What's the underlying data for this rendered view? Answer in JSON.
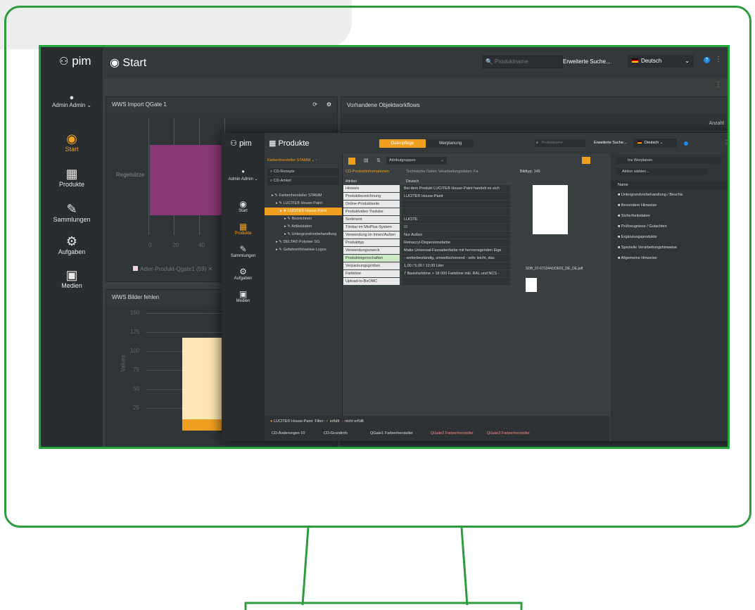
{
  "back": {
    "logo": "pim",
    "user": "Admin Admin",
    "nav": [
      "Start",
      "Produkte",
      "Sammlungen",
      "Aufgaben",
      "Medien"
    ],
    "page_title": "Start",
    "search_placeholder": "Produktname",
    "extended_search": "Erweiterte Suche...",
    "language": "Deutsch",
    "panel1_title": "WWS Import QGate 1",
    "panel2_title": "Vorhandene Objektworkflows",
    "panel2_col": "Anzahl",
    "panel1_ylabel": "Regelsätze",
    "panel1_xticks": [
      "0",
      "20",
      "40"
    ],
    "panel1_legend": "Adler-Produkt-Qgate1 (59)",
    "panel3_title": "WWS Bilder fehlen",
    "panel3_yticks": [
      "150",
      "125",
      "100",
      "75",
      "50",
      "25"
    ],
    "panel3_ylabel": "Values"
  },
  "front": {
    "logo": "pim",
    "user": "Admin Admin",
    "nav": [
      "Start",
      "Produkte",
      "Sammlungen",
      "Aufgaben",
      "Medien"
    ],
    "page_title": "Produkte",
    "tab_active": "Datenpflege",
    "tab_other": "Werplanung",
    "search_placeholder": "Produktname",
    "extended_search": "Erweiterte Suche...",
    "language": "Deutsch",
    "tree_header": "Farbenhersteller STAMM",
    "tree_search1": "CD-Rezepte",
    "tree_search2": "CD-Artikel",
    "tree": [
      "Farbenhersteller STAMM",
      "LUCITE® House-Paint",
      "LUCITE® House-Paint",
      "Bezeichnen",
      "Artikeldaten",
      "Untergrundvorbehandlung",
      "DELTA® Polymer SG",
      "Gefahrenhinweise-Logos"
    ],
    "toolbar_select": "Attributgruppen",
    "tabs": [
      "CD-Produktinformationen",
      "Technische Daten",
      "Verarbeitungsdaten",
      "Fa"
    ],
    "col_attr": "Attribut",
    "col_val": "Deutsch",
    "rows": [
      {
        "label": "Hinweis",
        "value": "Bei dem Produkt LUCITE® House-Paint handelt es sich"
      },
      {
        "label": "Produktbezeichnung",
        "value": "LUCITE® House-Paint"
      },
      {
        "label": "Online-Produktseite",
        "value": ""
      },
      {
        "label": "Produktvideo Youtube",
        "value": ""
      },
      {
        "label": "Sortiment",
        "value": "LUCITE"
      },
      {
        "label": "Tönbar im MixPlus-System",
        "value": "☑"
      },
      {
        "label": "Verwendung im Innen/Außen",
        "value": "Nur Außen"
      },
      {
        "label": "Produkttyp",
        "value": "Reinacryl-Dispersionsfarbe"
      },
      {
        "label": "Verwendungszweck",
        "value": "Matte Universal-Fassadenfarbe mit hervorragenden Eige"
      },
      {
        "label": "Produkteigenschaften",
        "value": "- wetterbeständig, umweltschonend - sehr leicht, dau"
      },
      {
        "label": "Verpackungsgrößen",
        "value": "1,00 / 5,00 / 12,00 Liter"
      },
      {
        "label": "Farbtöne",
        "value": "7 Basisfarbtöne > 18 000 Farbtöne inkl. RAL und NCS -"
      },
      {
        "label": "Upload-to-BirOMC",
        "value": ""
      }
    ],
    "bildtyp": "Bildtyp: 146",
    "doc_name": "SDB_07-6713441/DE01_DE_DE.pdf",
    "right_select": "Ins Werplanen",
    "right_action": "Aktion wählen...",
    "right_header": "Name",
    "right_items": [
      "Untergrundvorbehandlung / Beschic",
      "Besondere Hinweise",
      "Sicherheitsdaten",
      "Prüfzeugnisse / Gutachten",
      "Ergänzungsprodukte",
      "Spezielle Verarbeitungshinweise",
      "Allgemeine Hinweise"
    ],
    "bottom_product": "LUCITE® House-Paint",
    "filter_label": "Filter:",
    "filter_ok": "erfüllt",
    "filter_nok": "nicht erfüllt",
    "chips": [
      "CD-Änderungen 10",
      "CD-Grundinfo",
      "QGate1 Farbenhersteller",
      "QGate2 Farbenhersteller",
      "QGate3 Farbenhersteller"
    ]
  },
  "colors": {
    "frame": "#2e9c3e",
    "accent": "#f0a020",
    "purple": "#8a3a73",
    "cream": "#fde7b4",
    "orange": "#f0a020"
  }
}
